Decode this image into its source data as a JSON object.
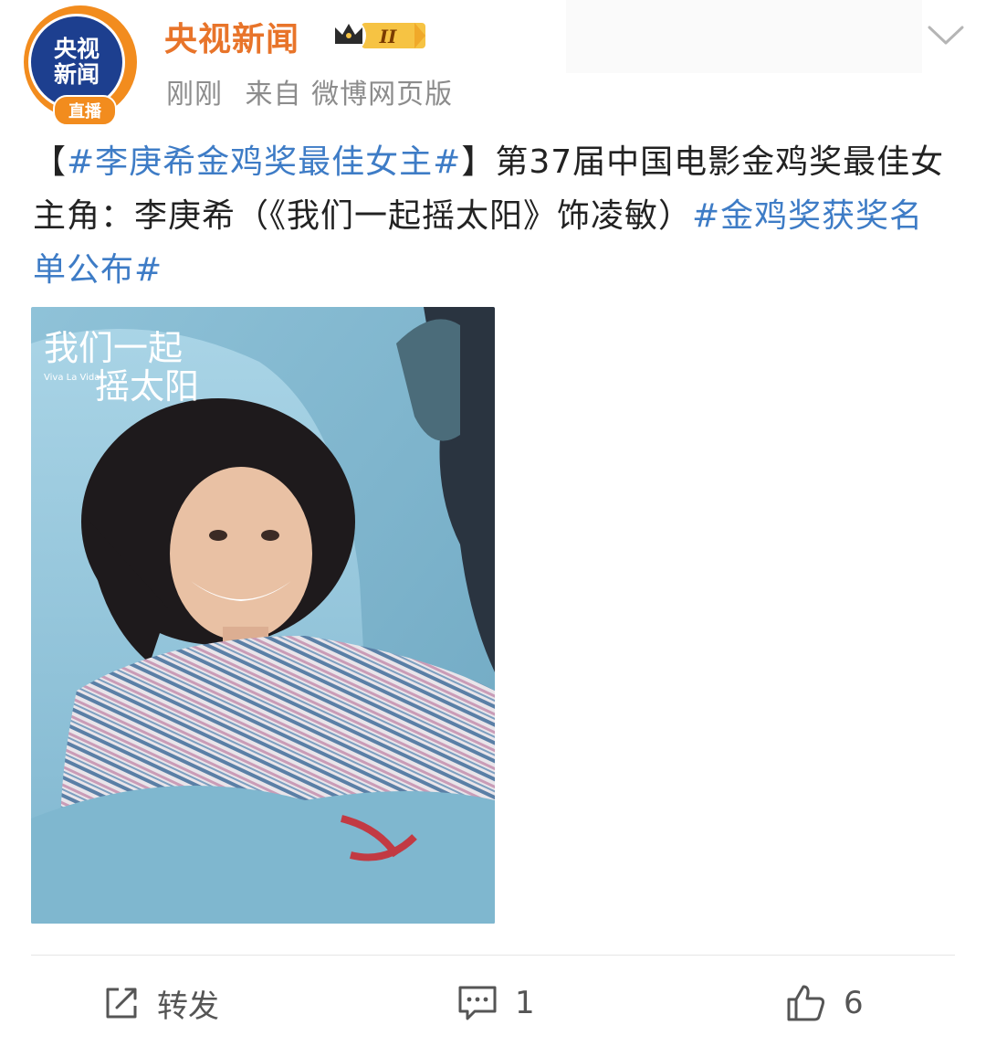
{
  "account": {
    "avatar_line1": "央视",
    "avatar_line2": "新闻",
    "avatar_live": "直播",
    "name": "央视新闻",
    "badge_icon": "crown-icon",
    "badge_level": "II"
  },
  "meta": {
    "time": "刚刚",
    "source": "来自 微博网页版"
  },
  "post": {
    "topic1": "#李庚希金鸡奖最佳女主#",
    "bracket_open": "【",
    "bracket_close": "】",
    "text": "第37届中国电影金鸡奖最佳女主角：李庚希（《我们一起摇太阳》饰凌敏）",
    "topic2": "#金鸡奖获奖名单公布#"
  },
  "image": {
    "title_line1": "我们一起",
    "title_line2": "摇太阳",
    "subtitle": "Viva La Vida"
  },
  "actions": {
    "repost_label": "转发",
    "comment_count": "1",
    "like_count": "6"
  },
  "colors": {
    "brand_orange": "#e8742a",
    "topic_blue": "#3e7cc6",
    "meta_gray": "#8c8c8c"
  }
}
